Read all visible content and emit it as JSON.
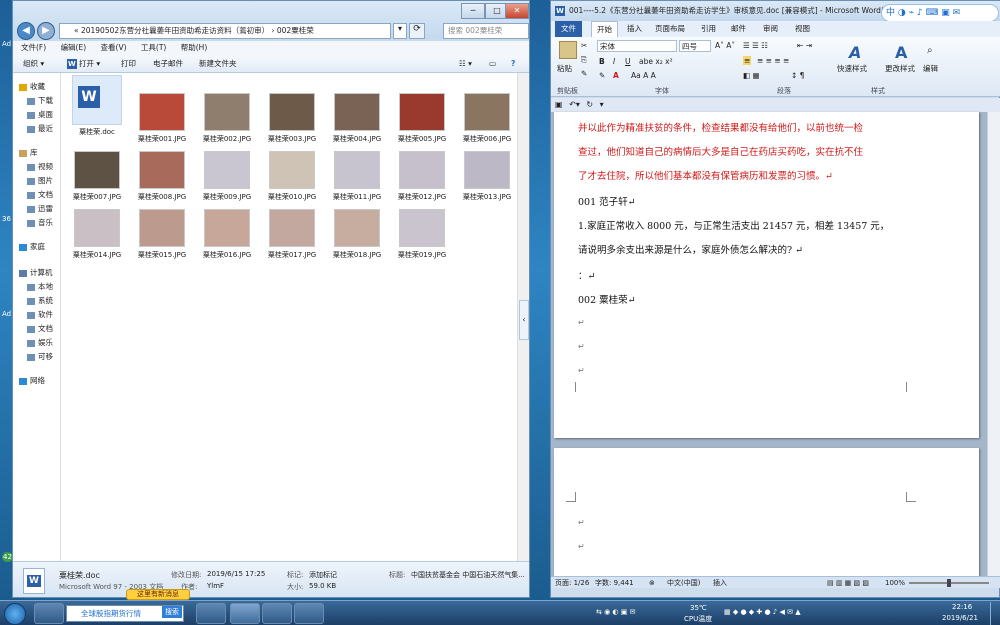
{
  "explorer": {
    "address": "« 20190502东营分社曩萎年田资助希走访资料（蔫初审） › 002粟桂荣",
    "search_placeholder": "搜索 002粟桂荣",
    "menu": [
      "文件(F)",
      "编辑(E)",
      "查看(V)",
      "工具(T)",
      "帮助(H)"
    ],
    "toolbar": {
      "organize": "组织 ▾",
      "open": "打开 ▾",
      "print": "打印",
      "email": "电子邮件",
      "new_folder": "新建文件夹"
    },
    "nav": [
      {
        "label": "收藏",
        "icon": "star-icon"
      },
      {
        "label": "下载",
        "icon": "download-icon"
      },
      {
        "label": "桌面",
        "icon": "desktop-icon"
      },
      {
        "label": "最近",
        "icon": "recent-icon"
      },
      {
        "label": "库",
        "icon": "library-icon"
      },
      {
        "label": "视频",
        "icon": "video-icon"
      },
      {
        "label": "图片",
        "icon": "picture-icon"
      },
      {
        "label": "文档",
        "icon": "document-icon"
      },
      {
        "label": "迅雷",
        "icon": "thunder-icon"
      },
      {
        "label": "音乐",
        "icon": "music-icon"
      },
      {
        "label": "家庭",
        "icon": "homegroup-icon"
      },
      {
        "label": "计算机",
        "icon": "computer-icon"
      },
      {
        "label": "本地",
        "icon": "drive-icon"
      },
      {
        "label": "系统",
        "icon": "drive-icon"
      },
      {
        "label": "软件",
        "icon": "drive-icon"
      },
      {
        "label": "文档",
        "icon": "drive-icon"
      },
      {
        "label": "娱乐",
        "icon": "drive-icon"
      },
      {
        "label": "可移",
        "icon": "removable-icon"
      },
      {
        "label": "网络",
        "icon": "network-icon"
      }
    ],
    "files": [
      {
        "name": "粟桂荣.doc",
        "type": "doc"
      },
      {
        "name": "粟桂荣001.JPG",
        "color": "#b94a3a"
      },
      {
        "name": "粟桂荣002.JPG",
        "color": "#8f7d6e"
      },
      {
        "name": "粟桂荣003.JPG",
        "color": "#6d5a48"
      },
      {
        "name": "粟桂荣004.JPG",
        "color": "#7a6254"
      },
      {
        "name": "粟桂荣005.JPG",
        "color": "#9a3a2f"
      },
      {
        "name": "粟桂荣006.JPG",
        "color": "#8a7560"
      },
      {
        "name": "粟桂荣007.JPG",
        "color": "#5e5244"
      },
      {
        "name": "粟桂荣008.JPG",
        "color": "#a86a5a"
      },
      {
        "name": "粟桂荣009.JPG",
        "color": "#c9c6d2"
      },
      {
        "name": "粟桂荣010.JPG",
        "color": "#cfc3b6"
      },
      {
        "name": "粟桂荣011.JPG",
        "color": "#c8c4cf"
      },
      {
        "name": "粟桂荣012.JPG",
        "color": "#c5c0cc"
      },
      {
        "name": "粟桂荣013.JPG",
        "color": "#bdb8c6"
      },
      {
        "name": "粟桂荣014.JPG",
        "color": "#c9bfc4"
      },
      {
        "name": "粟桂荣015.JPG",
        "color": "#bd9a8e"
      },
      {
        "name": "粟桂荣016.JPG",
        "color": "#c6a79a"
      },
      {
        "name": "粟桂荣017.JPG",
        "color": "#c3a8a0"
      },
      {
        "name": "粟桂荣018.JPG",
        "color": "#c7aca0"
      },
      {
        "name": "粟桂荣019.JPG",
        "color": "#cac4cf"
      }
    ],
    "details": {
      "name": "粟桂荣.doc",
      "type": "Microsoft Word 97 - 2003 文档",
      "modified_label": "修改日期:",
      "modified": "2019/6/15 17:25",
      "author_label": "作者:",
      "author": "YlmF",
      "tags_label": "标记:",
      "tags": "添加标记",
      "size_label": "大小:",
      "size": "59.0 KB",
      "title_label": "标题:",
      "title": "中国扶贫基金会  中国石油天然气集..."
    }
  },
  "word": {
    "title": "001----5.2《东营分社曩萎年田资助希走访学生》审核意见.doc [兼容模式] - Microsoft Word(产品...",
    "ime": "中 ◑ ⌁ ♪ ⌨ ▣ ✉",
    "tabs": [
      "文件",
      "开始",
      "插入",
      "页面布局",
      "引用",
      "邮件",
      "审阅",
      "视图"
    ],
    "ribbon": {
      "paste": "粘贴",
      "font": "宋体",
      "size": "四号",
      "quick_styles": "快速样式",
      "change_styles": "更改样式",
      "edit": "编辑",
      "groups": [
        "剪贴板",
        "字体",
        "段落",
        "样式"
      ]
    },
    "doc_lines": [
      {
        "text": "并以此作为精准扶贫的条件，检查结果都没有给他们，以前也统一检",
        "red": true
      },
      {
        "text": "查过，他们知道自己的病情后大多是自己在药店买药吃，实在抗不住",
        "red": true
      },
      {
        "text": "了才去住院，所以他们基本都没有保管病历和发票的习惯。↵",
        "red": true
      },
      {
        "text": "001 范子轩↵",
        "red": false
      },
      {
        "text": "1.家庭正常收入 8000 元，与正常生活支出 21457 元，相差 13457 元，",
        "red": false
      },
      {
        "text": "请说明多余支出来源是什么，家庭外债怎么解决的? ↵",
        "red": false
      },
      {
        "text": "：↵",
        "red": false
      },
      {
        "text": "002 粟桂荣↵",
        "red": false
      }
    ],
    "status": {
      "page": "页面: 1/26",
      "words": "字数: 9,441",
      "lang": "中文(中国)",
      "mode": "插入",
      "zoom": "100%"
    }
  },
  "taskbar": {
    "search_text": "全球股指期货行情",
    "search_btn": "搜索",
    "notify": "这里有新消息",
    "temp": "35℃",
    "temp_label": "CPU温度",
    "time": "22:16",
    "date": "2019/6/21"
  }
}
